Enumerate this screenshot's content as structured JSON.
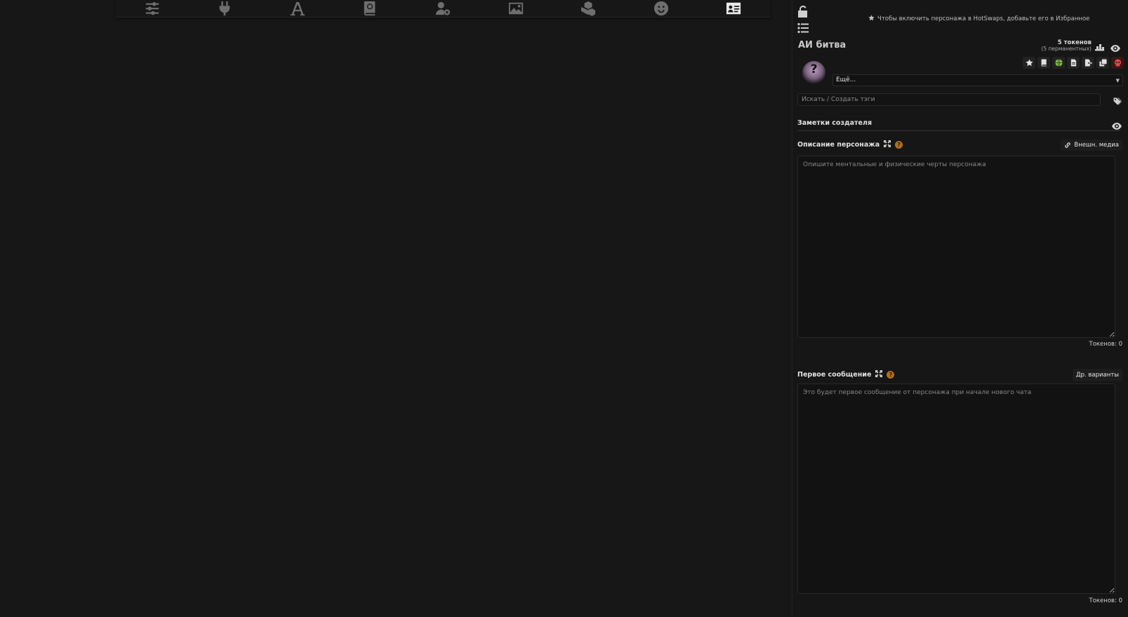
{
  "nav": {
    "icons": [
      "sliders-icon",
      "plug-icon",
      "font-icon",
      "book-atlas-icon",
      "user-gear-icon",
      "image-icon",
      "cubes-icon",
      "smiley-icon",
      "id-card-icon"
    ],
    "active": "id-card-icon"
  },
  "panel": {
    "hotswap_hint": "Чтобы включить персонажа в HotSwaps, добавьте его в Избранное",
    "character_name": "АИ битва",
    "tokens_main": "5 токенов",
    "tokens_sub": "(5 перманентных)",
    "more_select": "Ещё...",
    "tag_placeholder": "Искать / Создать тэги",
    "creator_notes_label": "Заметки создателя",
    "description_label": "Описание персонажа",
    "external_media_label": "Внешн. медиа",
    "description_placeholder": "Опишите ментальные и физические черты персонажа",
    "description_tokens": "Токенов: 0",
    "first_message_label": "Первое сообщение",
    "alt_greetings_label": "Др. варианты",
    "first_message_placeholder": "Это будет первое сообщение от персонажа при начале нового чата",
    "first_message_tokens": "Токенов: 0",
    "help_mark": "?"
  },
  "colors": {
    "background": "#171717",
    "accent_help": "#b46d1d",
    "danger": "#e04848",
    "globe": "#8ac64a"
  }
}
